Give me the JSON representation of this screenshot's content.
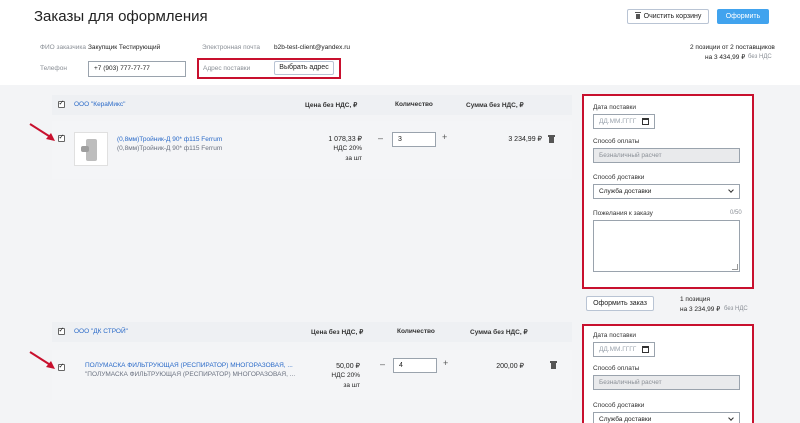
{
  "header": {
    "title": "Заказы для оформления",
    "clear_cart_label": "Очистить корзину",
    "checkout_label": "Оформить"
  },
  "customer": {
    "name_label": "ФИО заказчика",
    "name_value": "Закупщик Тестирующий",
    "email_label": "Электронная почта",
    "email_value": "b2b-test-client@yandex.ru",
    "phone_label": "Телефон",
    "phone_value": "+7 (903) 777-77-77",
    "address_label": "Адрес поставки",
    "address_button": "Выбрать адрес"
  },
  "summary": {
    "line1": "2 позиции от 2 поставщиков",
    "total": "на 3 434,99 ₽",
    "vat_note": "без НДС"
  },
  "columns": {
    "price": "Цена без НДС, ₽",
    "qty": "Количество",
    "sum": "Сумма без НДС, ₽"
  },
  "groups": [
    {
      "supplier": "ООО \"КераМикс\"",
      "item": {
        "name_line1": "(0,8мм)Тройник-Д 90* ф115 Ferrum",
        "name_line2": "(0,8мм)Тройник-Д 90* ф115 Ferrum",
        "price": "1 078,33 ₽",
        "vat": "НДС 20%",
        "per": "за шт",
        "qty": "3",
        "sum": "3 234,99 ₽"
      },
      "panel": {
        "date_label": "Дата поставки",
        "date_placeholder": "ДД.ММ.ГГГГ",
        "payment_label": "Способ оплаты",
        "payment_value": "Безналичный расчет",
        "delivery_label": "Способ доставки",
        "delivery_value": "Служба доставки",
        "wishes_label": "Пожелания к заказу",
        "wishes_counter": "0/50"
      },
      "order_button": "Оформить заказ",
      "order_summary_line1": "1 позиция",
      "order_summary_total": "на 3 234,99 ₽",
      "order_summary_vat": "без НДС"
    },
    {
      "supplier": "ООО \"ДК СТРОЙ\"",
      "item": {
        "name_line1": "ПОЛУМАСКА ФИЛЬТРУЮЩАЯ (РЕСПИРАТОР) МНОГОРАЗОВАЯ, ...",
        "name_line2": "\"ПОЛУМАСКА ФИЛЬТРУЮЩАЯ (РЕСПИРАТОР) МНОГОРАЗОВАЯ, ...",
        "price": "50,00 ₽",
        "vat": "НДС 20%",
        "per": "за шт",
        "qty": "4",
        "sum": "200,00 ₽"
      },
      "panel": {
        "date_label": "Дата поставки",
        "date_placeholder": "ДД.ММ.ГГГГ",
        "payment_label": "Способ оплаты",
        "payment_value": "Безналичный расчет",
        "delivery_label": "Способ доставки",
        "delivery_value": "Служба доставки"
      }
    }
  ],
  "colors": {
    "accent": "#41a3ee",
    "link": "#2a6ac8",
    "annotation_red": "#c8102e"
  },
  "icons": [
    "trash-icon",
    "calendar-icon",
    "chevron-down-icon",
    "checkbox-icon",
    "plus-icon",
    "minus-icon",
    "arrow-annotation-icon"
  ]
}
